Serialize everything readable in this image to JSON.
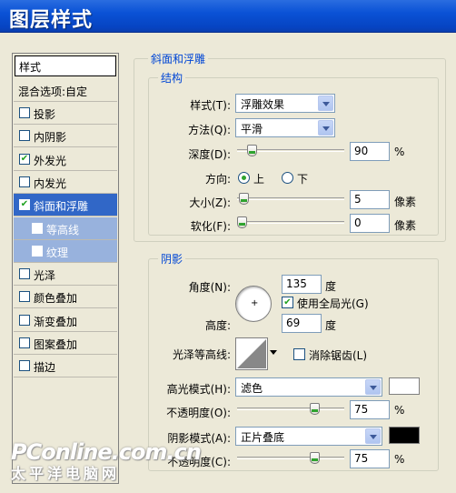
{
  "window": {
    "title": "图层样式"
  },
  "sidebar": {
    "header": "样式",
    "blend_options": "混合选项:自定",
    "items": [
      {
        "label": "投影",
        "checked": false
      },
      {
        "label": "内阴影",
        "checked": false
      },
      {
        "label": "外发光",
        "checked": true
      },
      {
        "label": "内发光",
        "checked": false
      },
      {
        "label": "斜面和浮雕",
        "checked": true,
        "selected": true
      },
      {
        "label": "等高线",
        "checked": false,
        "sub": true
      },
      {
        "label": "纹理",
        "checked": false,
        "sub": true
      },
      {
        "label": "光泽",
        "checked": false
      },
      {
        "label": "颜色叠加",
        "checked": false
      },
      {
        "label": "渐变叠加",
        "checked": false
      },
      {
        "label": "图案叠加",
        "checked": false
      },
      {
        "label": "描边",
        "checked": false
      }
    ]
  },
  "bevel": {
    "section_title": "斜面和浮雕",
    "structure_title": "结构",
    "style_label": "样式(T):",
    "style_value": "浮雕效果",
    "technique_label": "方法(Q):",
    "technique_value": "平滑",
    "depth_label": "深度(D):",
    "depth_value": "90",
    "depth_unit": "%",
    "depth_fraction": 0.1,
    "direction_label": "方向:",
    "direction_up": "上",
    "direction_down": "下",
    "size_label": "大小(Z):",
    "size_value": "5",
    "size_unit": "像素",
    "size_fraction": 0.02,
    "soften_label": "软化(F):",
    "soften_value": "0",
    "soften_unit": "像素",
    "soften_fraction": 0.0
  },
  "shading": {
    "title": "阴影",
    "angle_label": "角度(N):",
    "angle_value": "135",
    "angle_unit": "度",
    "global_light_label": "使用全局光(G)",
    "global_light_checked": true,
    "altitude_label": "高度:",
    "altitude_value": "69",
    "altitude_unit": "度",
    "gloss_contour_label": "光泽等高线:",
    "anti_aliased_label": "消除锯齿(L)",
    "highlight_mode_label": "高光模式(H):",
    "highlight_mode_value": "滤色",
    "highlight_color": "#ffffff",
    "highlight_opacity_label": "不透明度(O):",
    "highlight_opacity_value": "75",
    "highlight_opacity_unit": "%",
    "highlight_opacity_fraction": 0.75,
    "shadow_mode_label": "阴影模式(A):",
    "shadow_mode_value": "正片叠底",
    "shadow_color": "#000000",
    "shadow_opacity_label": "不透明度(C):",
    "shadow_opacity_value": "75",
    "shadow_opacity_unit": "%",
    "shadow_opacity_fraction": 0.75
  },
  "watermark": {
    "line1": "PConline.com.cn",
    "line2": "太平洋电脑网"
  }
}
